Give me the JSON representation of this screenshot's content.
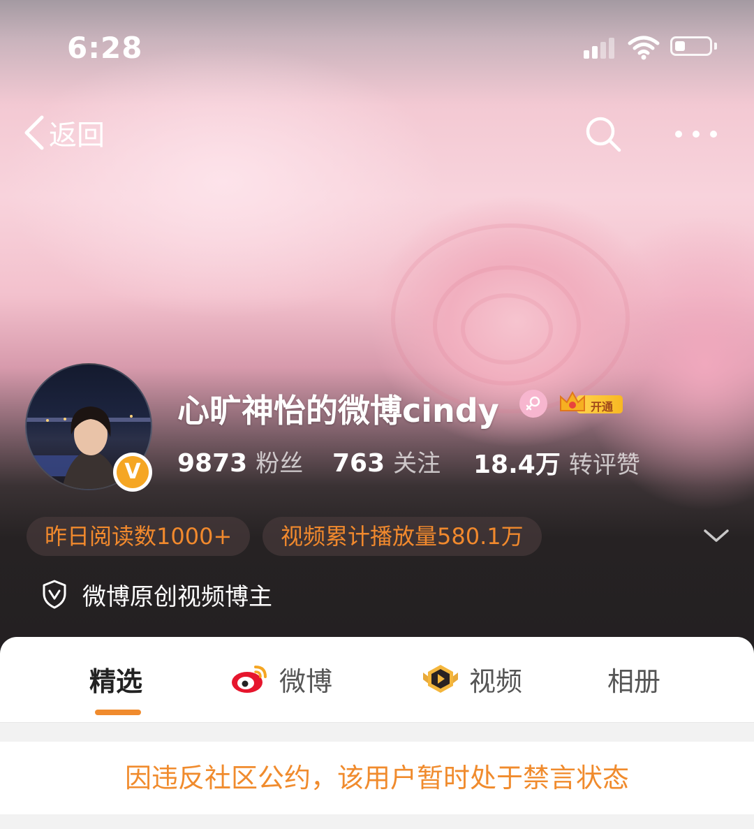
{
  "status_bar": {
    "time": "6:28",
    "signal_icon": "cellular-signal-icon",
    "wifi_icon": "wifi-icon",
    "battery_icon": "battery-icon"
  },
  "nav": {
    "back_label": "返回",
    "back_icon": "chevron-left-icon",
    "search_icon": "search-icon",
    "more_icon": "more-dots-icon"
  },
  "profile": {
    "username": "心旷神怡的微博cindy",
    "gender_icon": "female-icon",
    "verified_icon": "verified-v-icon",
    "vip_label": "开通",
    "stats": [
      {
        "value": "9873",
        "label": "粉丝"
      },
      {
        "value": "763",
        "label": "关注"
      },
      {
        "value": "18.4万",
        "label": "转评赞"
      }
    ],
    "tags": [
      "昨日阅读数1000+",
      "视频累计播放量580.1万"
    ],
    "certification": "微博原创视频博主"
  },
  "tabs": [
    {
      "label": "精选",
      "active": true
    },
    {
      "label": "微博",
      "active": false,
      "icon": "weibo-logo-icon"
    },
    {
      "label": "视频",
      "active": false,
      "icon": "video-play-icon"
    },
    {
      "label": "相册",
      "active": false
    }
  ],
  "notice": "因违反社区公约，该用户暂时处于禁言状态",
  "colors": {
    "accent": "#f08b2d",
    "verified": "#f5a623",
    "vip": "#ffd34d"
  }
}
